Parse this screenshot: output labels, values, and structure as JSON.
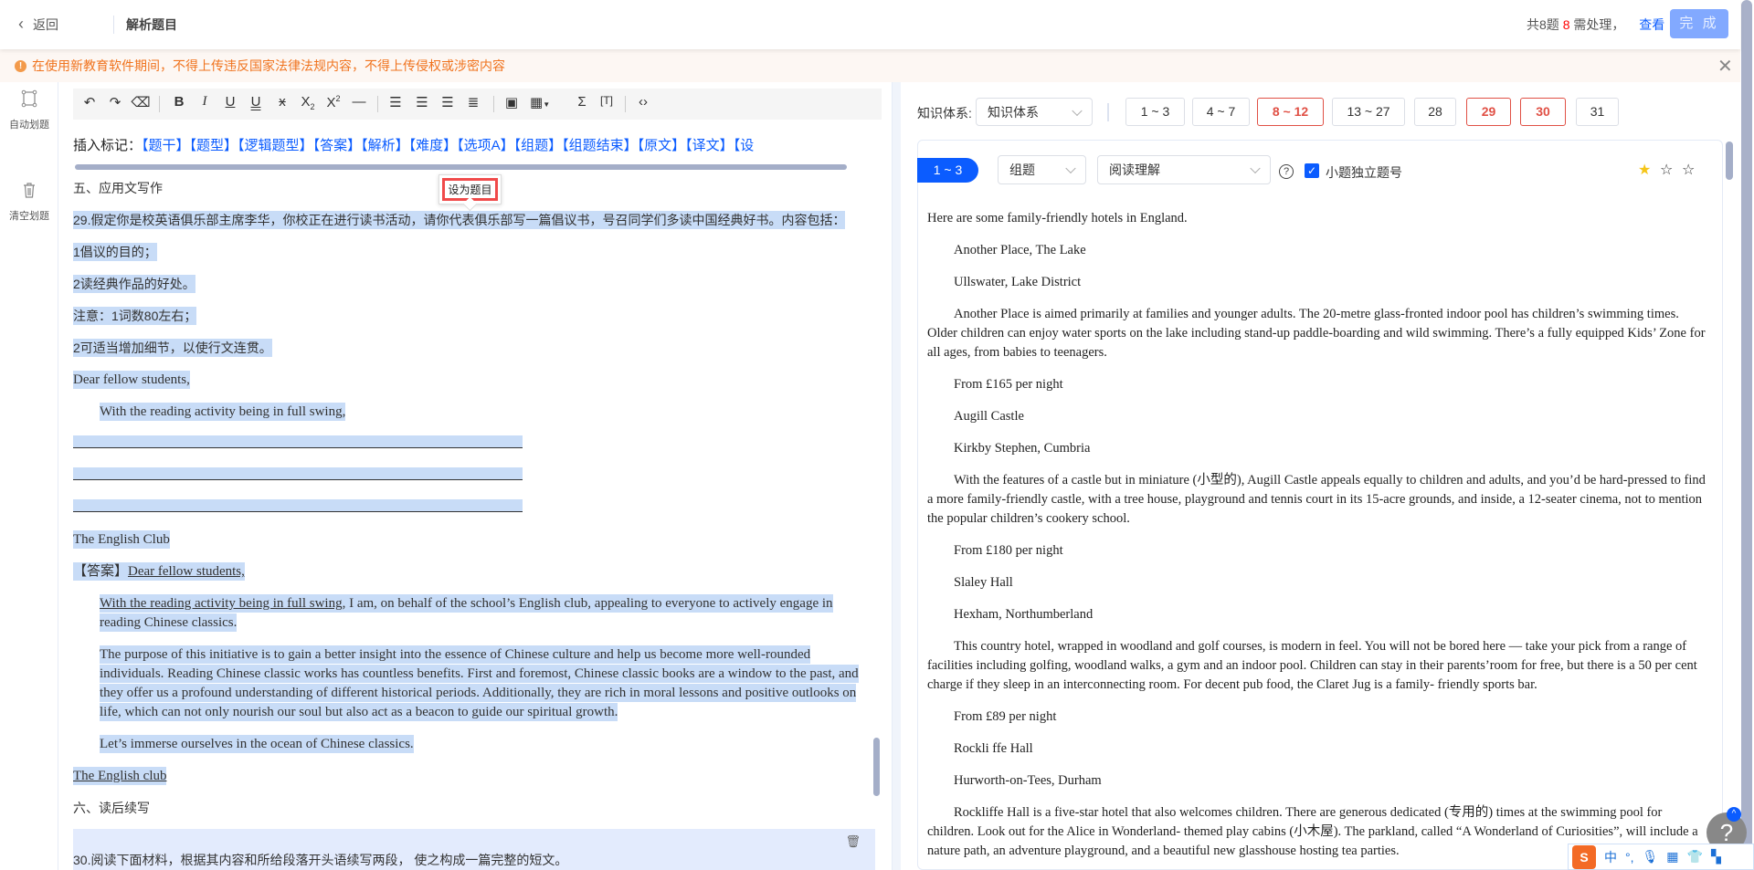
{
  "header": {
    "back_label": "返回",
    "title": "解析题目",
    "status_prefix": "共8题",
    "status_count": "8",
    "status_suffix": "需处理，",
    "view_link": "查看",
    "done_button": "完 成"
  },
  "warning": {
    "text": "在使用新教育软件期间，不得上传违反国家法律法规内容，不得上传侵权或涉密内容"
  },
  "sidebar": {
    "items": [
      {
        "label": "自动划题",
        "icon": "crop-frame-icon"
      },
      {
        "label": "清空划题",
        "icon": "trash-icon"
      }
    ]
  },
  "toolbar": {
    "icons": [
      "undo",
      "redo",
      "eraser",
      "bold",
      "italic",
      "underline",
      "double-underline",
      "strikethrough",
      "subscript",
      "superscript",
      "horizontal-rule",
      "align-left",
      "align-center",
      "align-right",
      "justify",
      "image",
      "table",
      "formula",
      "select-text",
      "source-code"
    ]
  },
  "insert_marks": {
    "label": "插入标记：",
    "tags": [
      "【题干】",
      "【题型】",
      "【逻辑题型】",
      "【答案】",
      "【解析】",
      "【难度】",
      "【选项A】",
      "【组题】",
      "【组题结束】",
      "【原文】",
      "【译文】",
      "【设"
    ]
  },
  "tooltip": {
    "label": "设为题目"
  },
  "editor": {
    "section5": "五、应用文写作",
    "q29_stem": "29.假定你是校英语俱乐部主席李华，你校正在进行读书活动，请你代表俱乐部写一篇倡议书，号召同学们多读中国经典好书。内容包括：",
    "req1": "1倡议的目的；",
    "req2": "2读经典作品的好处。",
    "note1": "注意：1词数80左右；",
    "note2": "2可适当增加细节，以使行文连贯。",
    "salutation": "Dear fellow students,",
    "opening": "With the reading activity being in full swing,",
    "signature": "The English Club",
    "answer_tag": "【答案】",
    "answer_salutation": "Dear fellow students,",
    "answer_p1_underlined": "With the reading activity being in full swing",
    "answer_p1_rest": ", I am, on behalf of the school’s English club, appealing to everyone to actively engage in reading Chinese classics.",
    "answer_p2": "The purpose of this initiative is to gain a better insight into the essence of Chinese culture and help us become more well-rounded individuals. Reading Chinese classic works has countless benefits. First and foremost, Chinese classic books are a window to the past, and they offer us a profound understanding of different historical periods. Additionally, they are rich in moral lessons and positive outlooks on life, which can not only nourish our soul but also act as a beacon to guide our spiritual growth.",
    "answer_p3": "Let’s immerse ourselves in the ocean of Chinese classics.",
    "answer_sign": "The English club",
    "section6": "六、读后续写",
    "q30_stem": "30.阅读下面材料，根据其内容和所给段落开头语续写两段， 使之构成一篇完整的短文。"
  },
  "right": {
    "knowledge_label": "知识体系:",
    "knowledge_select": "知识体系",
    "question_ranges": [
      {
        "label": "1 ~ 3",
        "flag": false
      },
      {
        "label": "4 ~ 7",
        "flag": false
      },
      {
        "label": "8 ~ 12",
        "flag": true
      },
      {
        "label": "13 ~ 27",
        "flag": false
      },
      {
        "label": "28",
        "flag": false
      },
      {
        "label": "29",
        "flag": true
      },
      {
        "label": "30",
        "flag": true
      },
      {
        "label": "31",
        "flag": false
      }
    ],
    "card": {
      "badge": "1 ~ 3",
      "type_select": "组题",
      "category_select": "阅读理解",
      "independent_numbering_label": "小题独立题号",
      "independent_numbering_checked": true,
      "difficulty_stars": 1,
      "difficulty_max": 3
    },
    "passage": [
      {
        "text": "Here are some family-friendly hotels in England.",
        "indent": false
      },
      {
        "text": "Another Place, The Lake",
        "indent": true
      },
      {
        "text": "Ullswater, Lake District",
        "indent": true
      },
      {
        "text": "Another Place is aimed primarily at families and younger adults. The 20-metre glass-fronted indoor pool has children’s swimming times. Older children can enjoy water sports on the lake including stand-up paddle-boarding and wild swimming. There’s a fully equipped Kids’ Zone for all ages, from babies to teenagers.",
        "indent": true
      },
      {
        "text": "From £165 per night",
        "indent": true
      },
      {
        "text": "Augill Castle",
        "indent": true
      },
      {
        "text": "Kirkby Stephen, Cumbria",
        "indent": true
      },
      {
        "text": "With the features of a castle but in miniature (小型的), Augill Castle appeals equally to children and adults, and you’d be hard-pressed to find a more family-friendly castle, with a tree house, playground and tennis court in its 15-acre grounds, and inside, a 12-seater cinema, not to mention the popular children’s cookery school.",
        "indent": true
      },
      {
        "text": "From £180 per night",
        "indent": true
      },
      {
        "text": "Slaley Hall",
        "indent": true
      },
      {
        "text": "Hexham, Northumberland",
        "indent": true
      },
      {
        "text": "This country hotel, wrapped in woodland and golf courses, is modern in feel. You will not be bored here — take your pick from a range of facilities including golfing, woodland walks, a gym and an indoor pool. Children can stay in their parents’room for free, but there is a 50 per cent charge if they sleep in an interconnecting room. For decent pub food, the Claret Jug is a family- friendly sports bar.",
        "indent": true
      },
      {
        "text": "From £89 per night",
        "indent": true
      },
      {
        "text": "Rockli ffe Hall",
        "indent": true
      },
      {
        "text": "Hurworth-on-Tees, Durham",
        "indent": true
      },
      {
        "text": "Rockliffe Hall is a five-star hotel that also welcomes children. There are generous dedicated (专用的) times at the swimming pool for children. Look out for the Alice in Wonderland- themed play cabins (小木屋). The parkland, called “A Wonderland of Curiosities”, will include a nature path, an adventure playground, and a beautiful new glasshouse hosting tea parties.",
        "indent": true
      }
    ]
  },
  "floating": {
    "help": "?",
    "ime_mode": "中"
  },
  "colors": {
    "accent": "#0b5cff",
    "flag": "#e05045",
    "highlight": "#c8dcf7",
    "warning": "#f0731e",
    "done_button": "#82a9ff"
  }
}
